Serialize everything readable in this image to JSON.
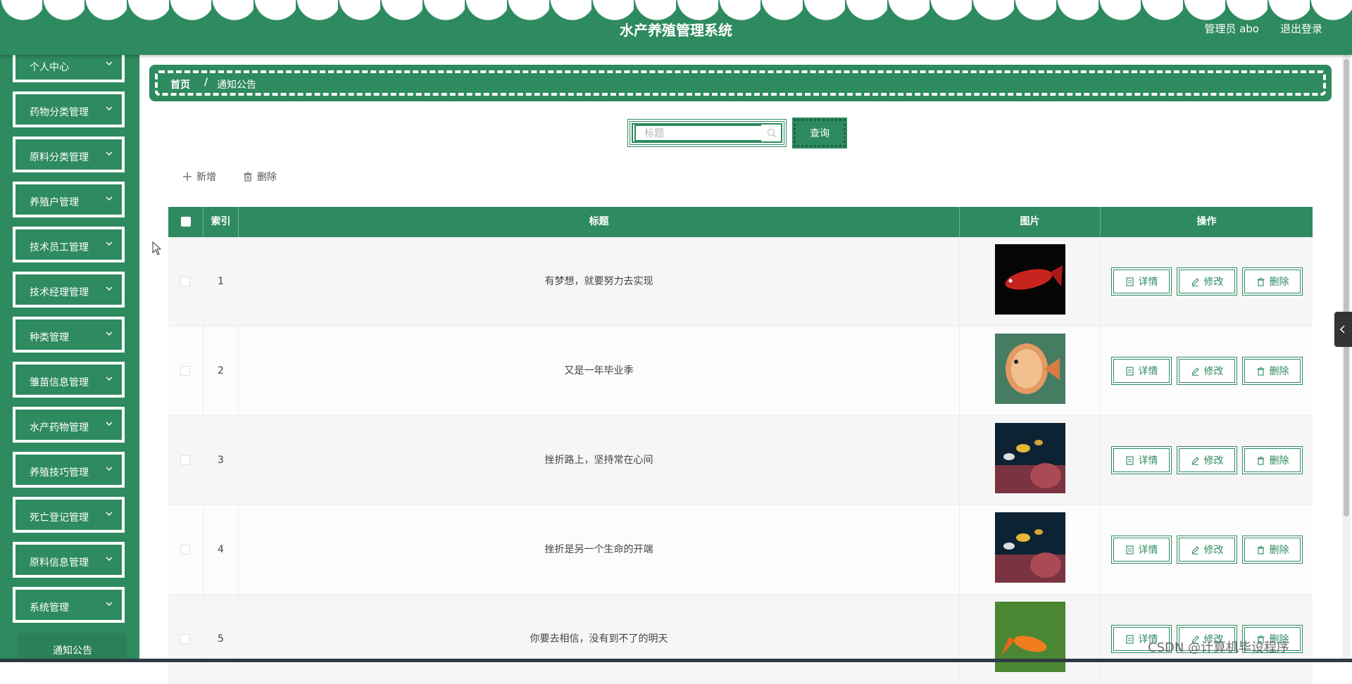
{
  "header": {
    "title": "水产养殖管理系统",
    "user_label": "管理员 abo",
    "logout_label": "退出登录"
  },
  "sidebar": {
    "items": [
      {
        "label": "个人中心"
      },
      {
        "label": "药物分类管理"
      },
      {
        "label": "原料分类管理"
      },
      {
        "label": "养殖户管理"
      },
      {
        "label": "技术员工管理"
      },
      {
        "label": "技术经理管理"
      },
      {
        "label": "种类管理"
      },
      {
        "label": "雏苗信息管理"
      },
      {
        "label": "水产药物管理"
      },
      {
        "label": "养殖技巧管理"
      },
      {
        "label": "死亡登记管理"
      },
      {
        "label": "原料信息管理"
      },
      {
        "label": "系统管理"
      }
    ],
    "submenu": {
      "label": "通知公告"
    }
  },
  "breadcrumb": {
    "home": "首页",
    "separator": "/",
    "current": "通知公告"
  },
  "search": {
    "placeholder": "标题",
    "button_label": "查询"
  },
  "toolbar": {
    "add_label": "新增",
    "delete_label": "删除"
  },
  "table": {
    "columns": [
      "索引",
      "标题",
      "图片",
      "操作"
    ],
    "rows": [
      {
        "index": "1",
        "title": "有梦想，就要努力去实现"
      },
      {
        "index": "2",
        "title": "又是一年毕业季"
      },
      {
        "index": "3",
        "title": "挫折路上，坚持常在心间"
      },
      {
        "index": "4",
        "title": "挫折是另一个生命的开端"
      },
      {
        "index": "5",
        "title": "你要去相信，没有到不了的明天"
      }
    ],
    "actions": {
      "detail": "详情",
      "edit": "修改",
      "delete": "删除"
    }
  },
  "watermark": "CSDN @计算机毕设程序",
  "colors": {
    "primary": "#2e8a5f",
    "white": "#ffffff"
  }
}
